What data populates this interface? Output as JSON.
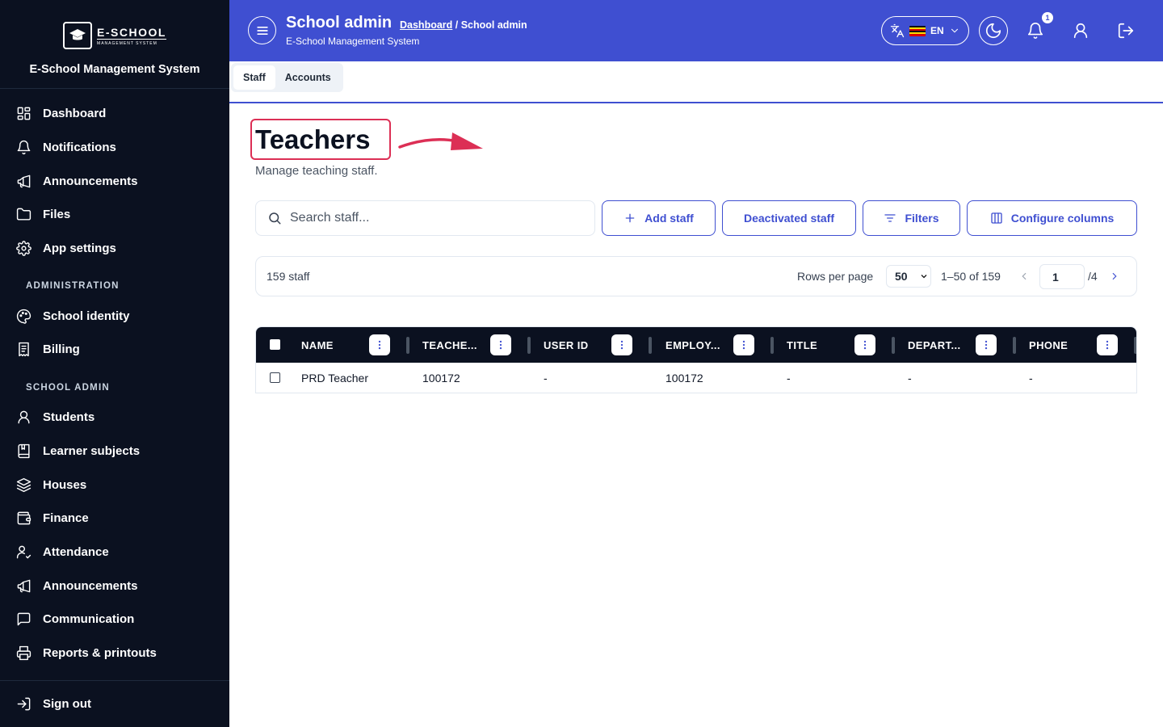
{
  "sidebar": {
    "logo_title": "E-SCHOOL",
    "logo_subtitle": "MANAGEMENT SYSTEM",
    "system_name": "E-School Management System",
    "items": [
      {
        "label": "Dashboard",
        "icon": "grid-icon"
      },
      {
        "label": "Notifications",
        "icon": "bell-icon"
      },
      {
        "label": "Announcements",
        "icon": "megaphone-icon"
      },
      {
        "label": "Files",
        "icon": "folder-icon"
      },
      {
        "label": "App settings",
        "icon": "gear-icon"
      }
    ],
    "section_admin": "ADMINISTRATION",
    "admin_items": [
      {
        "label": "School identity",
        "icon": "palette-icon"
      },
      {
        "label": "Billing",
        "icon": "receipt-icon"
      }
    ],
    "section_school": "SCHOOL ADMIN",
    "school_items": [
      {
        "label": "Students",
        "icon": "user-icon"
      },
      {
        "label": "Learner subjects",
        "icon": "book-icon"
      },
      {
        "label": "Houses",
        "icon": "layers-icon"
      },
      {
        "label": "Finance",
        "icon": "wallet-icon"
      },
      {
        "label": "Attendance",
        "icon": "user-check-icon"
      },
      {
        "label": "Announcements",
        "icon": "megaphone-icon"
      },
      {
        "label": "Communication",
        "icon": "message-icon"
      },
      {
        "label": "Reports & printouts",
        "icon": "printer-icon"
      }
    ],
    "sign_out": "Sign out"
  },
  "header": {
    "title": "School admin",
    "breadcrumb_link": "Dashboard",
    "breadcrumb_rest": " / School admin",
    "subtitle": "E-School Management System",
    "language": "EN",
    "notification_count": "1",
    "bg_color": "#3f4fd1"
  },
  "tabs": [
    {
      "label": "Staff",
      "active": true
    },
    {
      "label": "Accounts",
      "active": false
    }
  ],
  "main": {
    "title": "Teachers",
    "subtitle": "Manage teaching staff.",
    "search_placeholder": "Search staff...",
    "buttons": {
      "add": "Add staff",
      "deactivated": "Deactivated staff",
      "filters": "Filters",
      "columns": "Configure columns"
    },
    "pager": {
      "count": "159 staff",
      "rows_per_page_label": "Rows per page",
      "rows_per_page": "50",
      "range": "1–50 of 159",
      "page": "1",
      "total_pages": "/4"
    },
    "columns": [
      "NAME",
      "TEACHE...",
      "USER ID",
      "EMPLOY...",
      "TITLE",
      "DEPART...",
      "PHONE"
    ],
    "rows": [
      [
        "PRD Teacher",
        "100172",
        "-",
        "100172",
        "-",
        "-",
        "-"
      ]
    ]
  }
}
